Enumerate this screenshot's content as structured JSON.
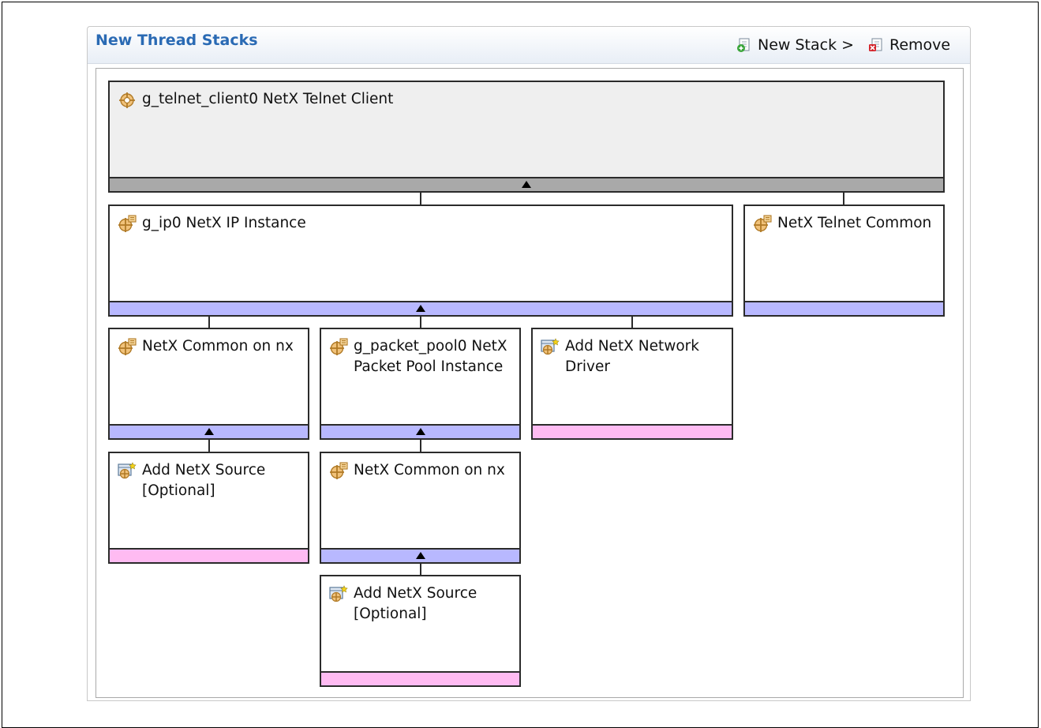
{
  "panel": {
    "title": "New Thread Stacks",
    "new_stack_label": "New Stack >",
    "remove_label": "Remove"
  },
  "colors": {
    "title_blue": "#2a6ab4",
    "header_bar_grey": "#a9a9a9",
    "module_bar_blue": "#b8b8ff",
    "optional_bar_pink": "#ffbbf2",
    "top_box_grey": "#efefef"
  },
  "icons": {
    "module": "module-gear-icon",
    "add_optional": "add-module-icon",
    "new_stack": "new-stack-icon",
    "remove": "remove-icon"
  },
  "stack": {
    "telnet_client": {
      "label": "g_telnet_client0 NetX Telnet Client"
    },
    "ip_instance": {
      "label": "g_ip0 NetX IP Instance"
    },
    "telnet_common": {
      "label": "NetX Telnet Common"
    },
    "common_on_nx_1": {
      "label": "NetX Common on nx"
    },
    "packet_pool": {
      "label": "g_packet_pool0 NetX Packet Pool Instance"
    },
    "network_driver": {
      "label": "Add NetX Network Driver"
    },
    "source_optional_1": {
      "label": "Add NetX Source [Optional]"
    },
    "common_on_nx_2": {
      "label": "NetX Common on nx"
    },
    "source_optional_2": {
      "label": "Add NetX Source [Optional]"
    }
  }
}
